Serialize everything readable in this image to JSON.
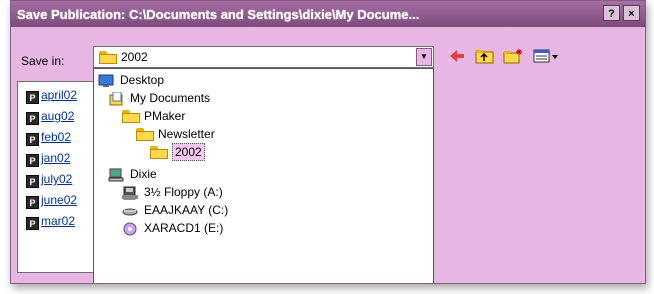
{
  "window": {
    "title": "Save Publication: C:\\Documents and Settings\\dixie\\My Docume...",
    "help_btn": "?",
    "close_btn": "×"
  },
  "savein": {
    "label": "Save in:",
    "value": "2002"
  },
  "toolbar": [
    "back-arrow-icon",
    "up-folder-icon",
    "new-folder-icon",
    "views-menu-icon"
  ],
  "files": [
    {
      "name": "april02"
    },
    {
      "name": "aug02"
    },
    {
      "name": "feb02"
    },
    {
      "name": "jan02"
    },
    {
      "name": "july02"
    },
    {
      "name": "june02"
    },
    {
      "name": "mar02"
    }
  ],
  "dropdown": [
    {
      "label": "Desktop",
      "icon": "desktop-icon"
    },
    {
      "label": "My Documents",
      "icon": "my-documents-icon"
    },
    {
      "label": "PMaker",
      "icon": "folder-icon"
    },
    {
      "label": "Newsletter",
      "icon": "folder-icon"
    },
    {
      "label": "2002",
      "icon": "folder-open-icon",
      "selected": true
    },
    {
      "label": "Dixie",
      "icon": "computer-icon"
    },
    {
      "label": "3½ Floppy (A:)",
      "icon": "floppy-icon"
    },
    {
      "label": "EAAJKAAY (C:)",
      "icon": "drive-icon"
    },
    {
      "label": "XARACD1 (E:)",
      "icon": "cd-drive-icon"
    }
  ],
  "colors": {
    "dialog_bg": "#e7b6e2",
    "titlebar": "#7e4a7d",
    "link": "#003399",
    "selection": "#f5c9ef"
  }
}
